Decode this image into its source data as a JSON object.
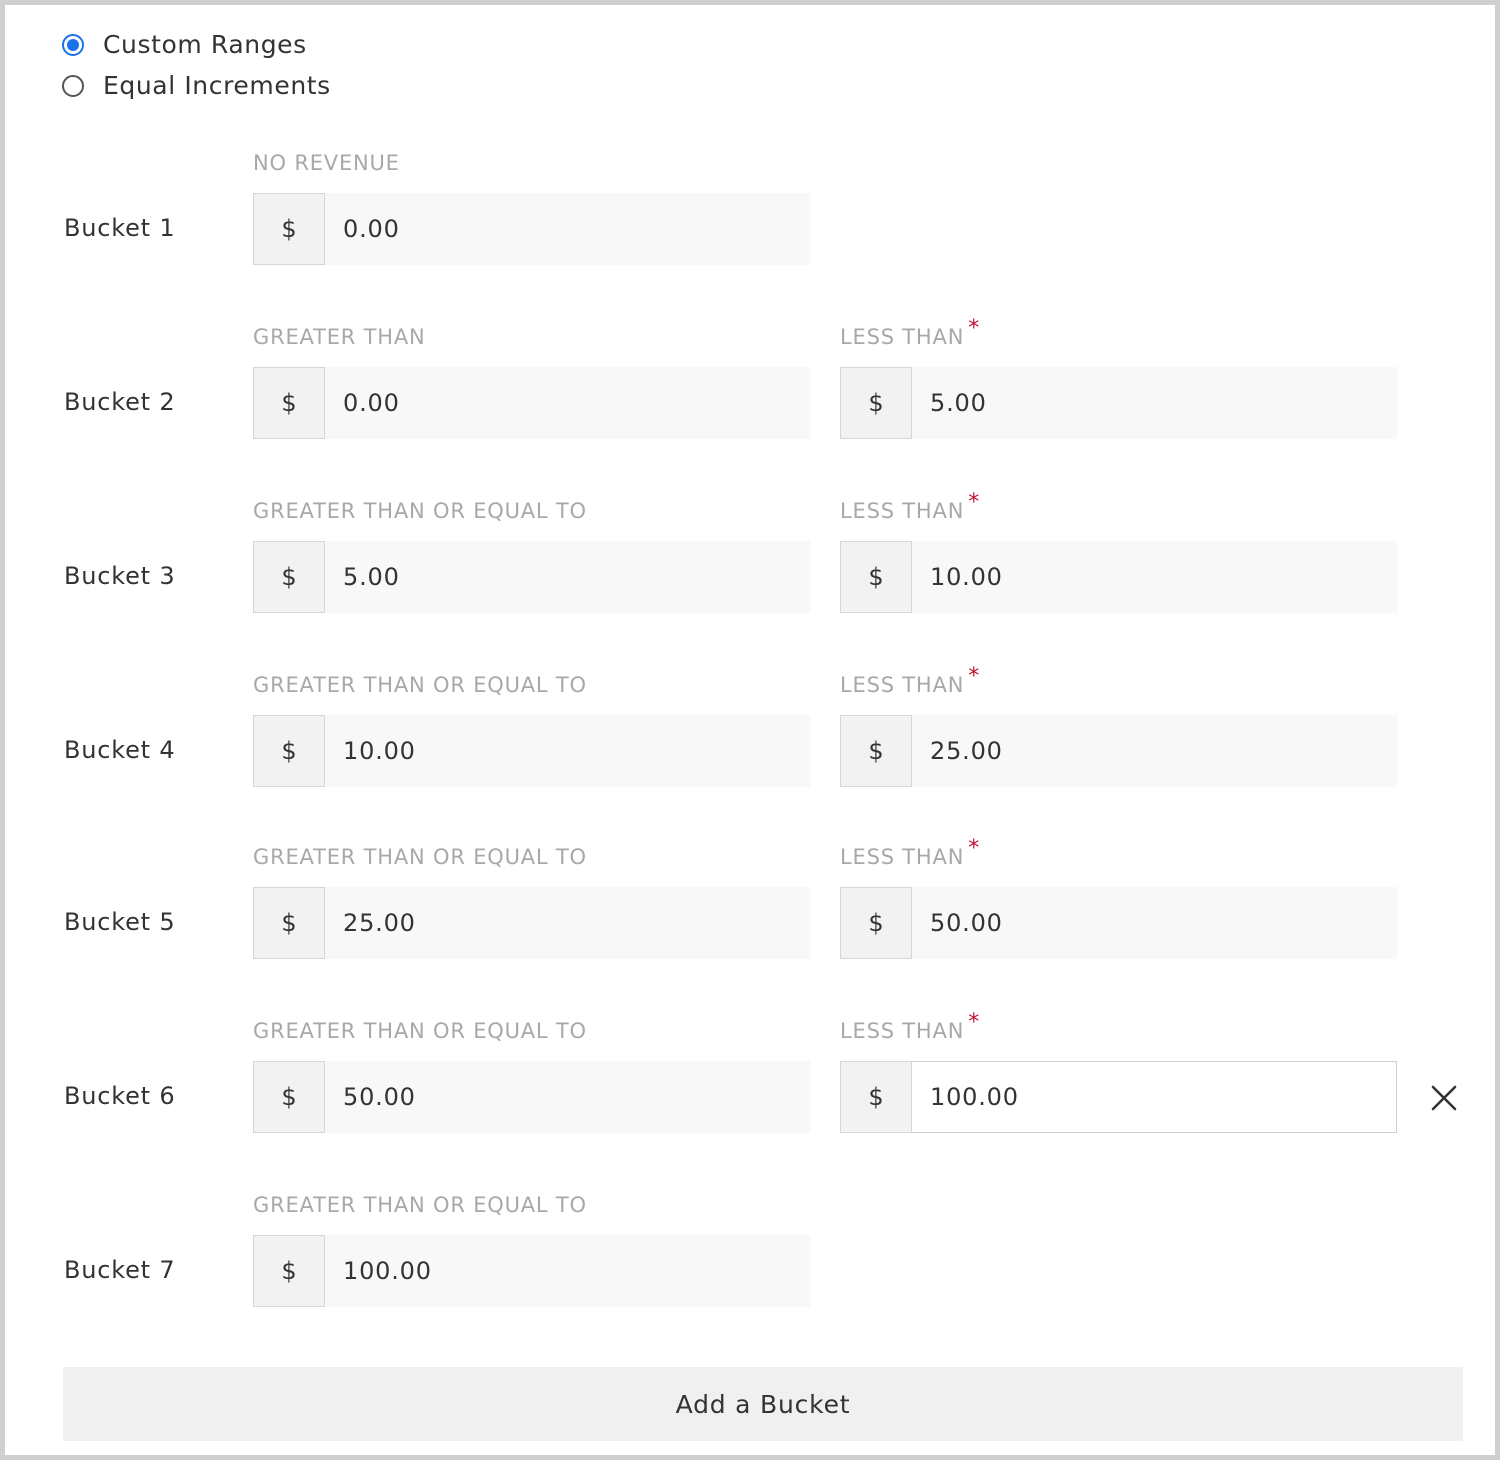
{
  "range_mode": {
    "options": [
      {
        "label": "Custom Ranges",
        "checked": true
      },
      {
        "label": "Equal Increments",
        "checked": false
      }
    ]
  },
  "currency_symbol": "$",
  "required_marker": "*",
  "buckets": [
    {
      "name": "Bucket 1",
      "min_label": "NO REVENUE",
      "min_value": "0.00"
    },
    {
      "name": "Bucket 2",
      "min_label": "GREATER THAN",
      "min_value": "0.00",
      "max_label": "LESS THAN",
      "max_value": "5.00"
    },
    {
      "name": "Bucket 3",
      "min_label": "GREATER THAN OR EQUAL TO",
      "min_value": "5.00",
      "max_label": "LESS THAN",
      "max_value": "10.00"
    },
    {
      "name": "Bucket 4",
      "min_label": "GREATER THAN OR EQUAL TO",
      "min_value": "10.00",
      "max_label": "LESS THAN",
      "max_value": "25.00"
    },
    {
      "name": "Bucket 5",
      "min_label": "GREATER THAN OR EQUAL TO",
      "min_value": "25.00",
      "max_label": "LESS THAN",
      "max_value": "50.00"
    },
    {
      "name": "Bucket 6",
      "min_label": "GREATER THAN OR EQUAL TO",
      "min_value": "50.00",
      "max_label": "LESS THAN",
      "max_value": "100.00"
    },
    {
      "name": "Bucket 7",
      "min_label": "GREATER THAN OR EQUAL TO",
      "min_value": "100.00"
    }
  ],
  "remove_icon": "close-icon",
  "add_button_label": "Add a Bucket",
  "colors": {
    "accent": "#1a73e8",
    "required": "#c0152f",
    "label_muted": "#a8a8a8",
    "text": "#333333"
  }
}
